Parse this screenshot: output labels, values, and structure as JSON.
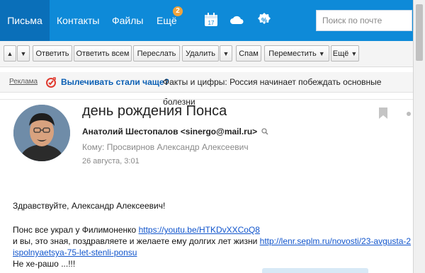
{
  "nav": {
    "tabs": [
      {
        "label": "Письма",
        "active": true
      },
      {
        "label": "Контакты"
      },
      {
        "label": "Файлы"
      },
      {
        "label": "Ещё",
        "badge": "2"
      }
    ],
    "icons": [
      "calendar-icon",
      "cloud-icon",
      "discount-icon"
    ],
    "calendar_day": "17",
    "search_placeholder": "Поиск по почте"
  },
  "toolbar": {
    "up_arrow": "▲",
    "down_arrow": "▼",
    "reply": "Ответить",
    "reply_all": "Ответить всем",
    "forward": "Переслать",
    "delete": "Удалить",
    "spam": "Спам",
    "move": "Переместить",
    "more": "Ещё"
  },
  "ad": {
    "label": "Реклама",
    "link": "Вылечивать стали чаще?",
    "text": "Факты и цифры: Россия начинает побеждать основные болезни"
  },
  "message": {
    "subject": "день рождения Понса",
    "sender": "Анатолий Шестопалов <sinergo@mail.ru>",
    "to": "Кому: Просвирнов Александр Алексеевич",
    "date": "26 августа, 3:01",
    "greeting": "Здравствуйте, Александр Алексеевич!",
    "line1_text": "Понс все украл у Филимоненко ",
    "line1_link": "https://youtu.be/HTKDvXXCoQ8",
    "line2_text": "и вы, это зная, поздравляете и желаете ему долгих лет жизни ",
    "line2_link": "http://lenr.seplm.ru/novosti/23-avgusta-2",
    "line3_link": "ispolnyaetsya-75-let-stenli-ponsu",
    "line4": "Не хе-рашо ...!!!"
  },
  "colors": {
    "nav_bg": "#0e8ad8",
    "nav_active": "#0a6fb9",
    "badge": "#f0a33b",
    "link": "#1155cc"
  }
}
